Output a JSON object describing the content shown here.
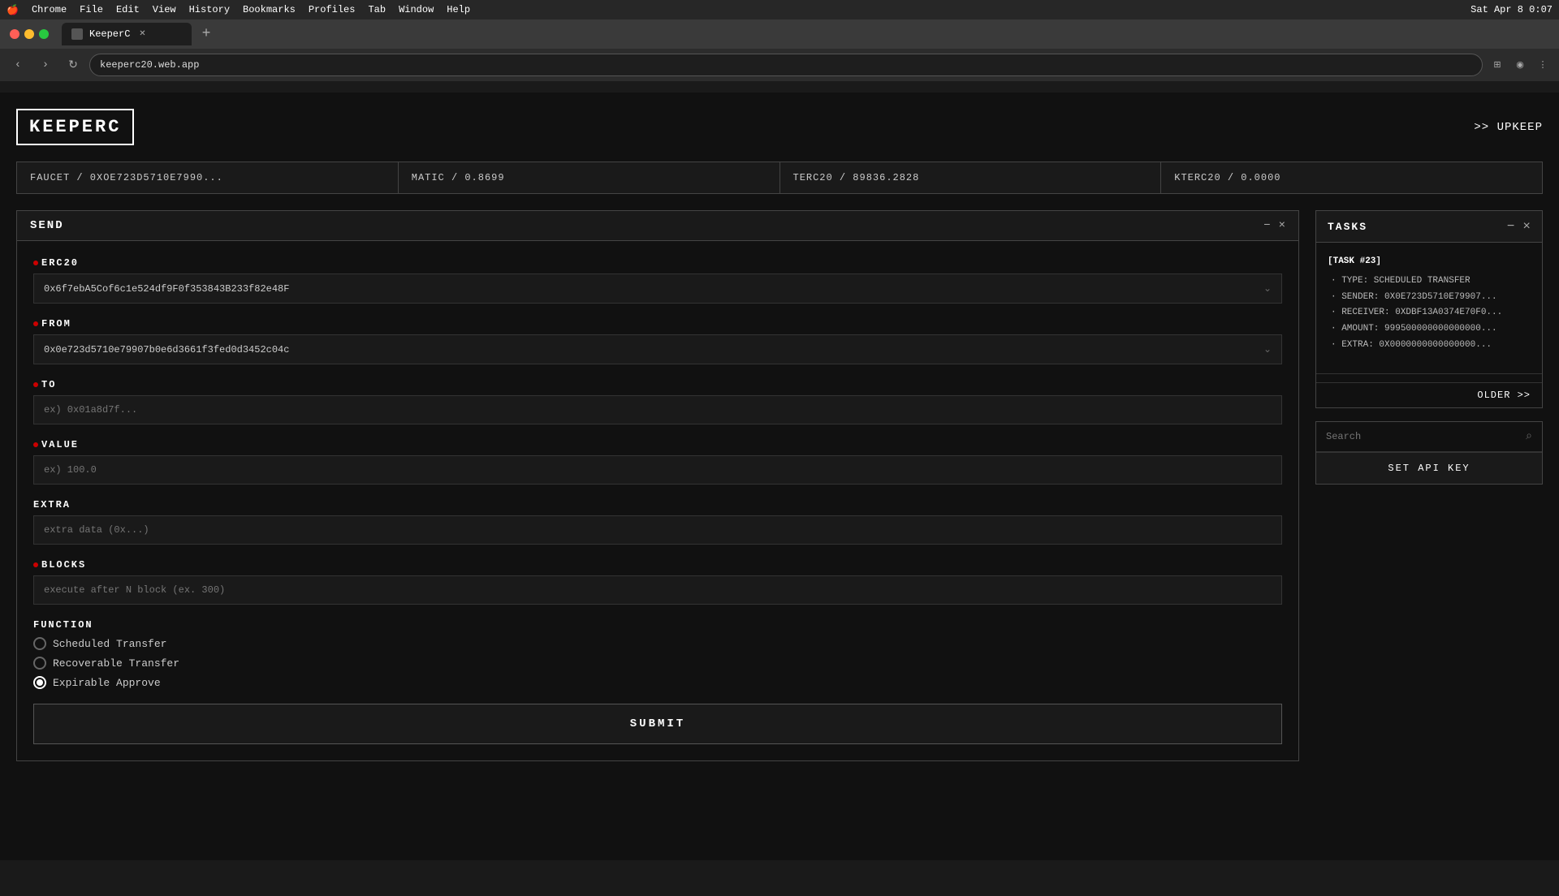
{
  "menubar": {
    "apple": "🍎",
    "items": [
      "Chrome",
      "File",
      "Edit",
      "View",
      "History",
      "Bookmarks",
      "Profiles",
      "Tab",
      "Window",
      "Help"
    ],
    "time": "Sat Apr 8  0:07"
  },
  "browser": {
    "tab_title": "KeeperC",
    "url": "keeperc20.web.app",
    "new_tab_label": "+"
  },
  "app": {
    "logo": "KEEPERC",
    "upkeep_label": ">> UPKEEP"
  },
  "stats": [
    {
      "label": "FAUCET / 0XOE723D5710E7990..."
    },
    {
      "label": "MATIC / 0.8699"
    },
    {
      "label": "TERC20 / 89836.2828"
    },
    {
      "label": "KTERC20 / 0.0000"
    }
  ],
  "send_panel": {
    "title": "SEND",
    "controls": [
      "−",
      "×"
    ],
    "erc20_label": "ERC20",
    "erc20_value": "0x6f7ebA5Cof6c1e524df9F0f353843B233f82e48F",
    "from_label": "FROM",
    "from_value": "0x0e723d5710e79907b0e6d3661f3fed0d3452c04c",
    "to_label": "TO",
    "to_placeholder": "ex) 0x01a8d7f...",
    "value_label": "VALUE",
    "value_placeholder": "ex) 100.0",
    "extra_label": "EXTRA",
    "extra_placeholder": "extra data (0x...)",
    "blocks_label": "BLOCKS",
    "blocks_placeholder": "execute after N block (ex. 300)",
    "function_label": "FUNCTION",
    "functions": [
      {
        "label": "Scheduled Transfer",
        "checked": false
      },
      {
        "label": "Recoverable Transfer",
        "checked": false
      },
      {
        "label": "Expirable Approve",
        "checked": true
      }
    ],
    "submit_label": "SUBMIT"
  },
  "tasks_panel": {
    "title": "TASKS",
    "controls": [
      "−",
      "×"
    ],
    "task_id": "[TASK #23]",
    "task_rows": [
      "· TYPE: SCHEDULED TRANSFER",
      "· SENDER: 0X0E723D5710E79907...",
      "· RECEIVER: 0XDBF13A0374E70F0...",
      "· AMOUNT: 999500000000000000...",
      "· EXTRA: 0X0000000000000000..."
    ],
    "older_label": "OLDER >>"
  },
  "search_panel": {
    "placeholder": "Search",
    "api_key_label": "SET API KEY"
  }
}
